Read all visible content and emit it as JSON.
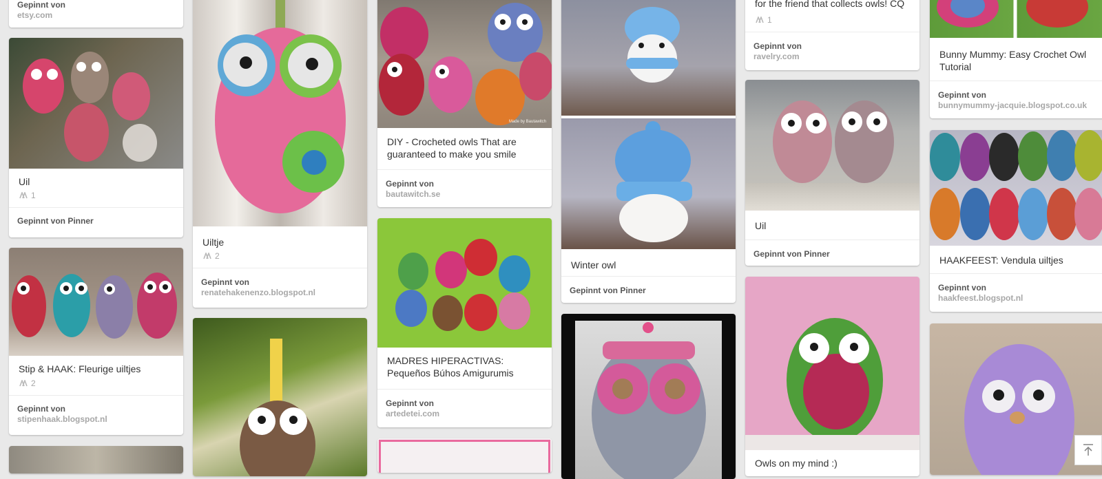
{
  "pins": {
    "c1_top": {
      "source": "etsy.com",
      "label": "Gepinnt von"
    },
    "c1_uil": {
      "description": "Uil",
      "repins": "1",
      "credit": "Gepinnt von Pinner"
    },
    "c1_stip": {
      "description": "Stip & HAAK: Fleurige uiltjes",
      "repins": "2",
      "label": "Gepinnt von",
      "source": "stipenhaak.blogspot.nl"
    },
    "c2_uiltje": {
      "description": "Uiltje",
      "repins": "2",
      "label": "Gepinnt von",
      "source": "renatehakenenzo.blogspot.nl"
    },
    "c3_diy": {
      "description": "DIY - Crocheted owls That are guaranteed to make you smile",
      "label": "Gepinnt von",
      "source": "bautawitch.se",
      "watermark": "Made by Bautawitch"
    },
    "c3_madres": {
      "description": "MADRES HIPERACTIVAS: Pequeños Búhos Amigurumis",
      "label": "Gepinnt von",
      "source": "artedetei.com"
    },
    "c4_winter": {
      "description": "Winter owl",
      "credit": "Gepinnt von Pinner"
    },
    "c5_top": {
      "description": "for the friend that collects owls! CQ",
      "repins": "1",
      "label": "Gepinnt von",
      "source": "ravelry.com"
    },
    "c5_uil": {
      "description": "Uil",
      "credit": "Gepinnt von Pinner"
    },
    "c5_bottom": {
      "description": "Owls on my mind :)"
    },
    "c6_bunny": {
      "description": "Bunny Mummy: Easy Crochet Owl Tutorial",
      "label": "Gepinnt von",
      "source": "bunnymummy-jacquie.blogspot.co.uk"
    },
    "c6_haak": {
      "description": "HAAKFEEST: Vendula uiltjes",
      "label": "Gepinnt von",
      "source": "haakfeest.blogspot.nl"
    }
  },
  "icons": {
    "repin": "pin-icon",
    "scroll_top": "arrow-up-to-line-icon"
  },
  "colors": {
    "background": "#e9e9e9",
    "source_text": "#a7a7a7",
    "credit_text": "#555555"
  }
}
